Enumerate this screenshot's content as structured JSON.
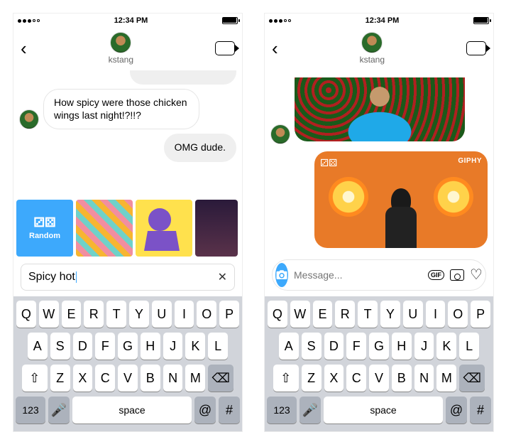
{
  "status": {
    "time": "12:34 PM"
  },
  "header": {
    "username": "kstang"
  },
  "left": {
    "messages": {
      "incoming": "How spicy were those chicken wings last night!?!!?",
      "outgoing": "OMG dude."
    },
    "gif": {
      "random_label": "Random"
    },
    "search": {
      "value": "Spicy hot"
    }
  },
  "right": {
    "gif_card": {
      "brand": "GIPHY"
    },
    "compose": {
      "placeholder": "Message...",
      "gif_label": "GIF"
    }
  },
  "keyboard": {
    "row1": [
      "Q",
      "W",
      "E",
      "R",
      "T",
      "Y",
      "U",
      "I",
      "O",
      "P"
    ],
    "row2": [
      "A",
      "S",
      "D",
      "F",
      "G",
      "H",
      "J",
      "K",
      "L"
    ],
    "row3": [
      "Z",
      "X",
      "C",
      "V",
      "B",
      "N",
      "M"
    ],
    "k123": "123",
    "space": "space",
    "at": "@",
    "hash": "#"
  }
}
